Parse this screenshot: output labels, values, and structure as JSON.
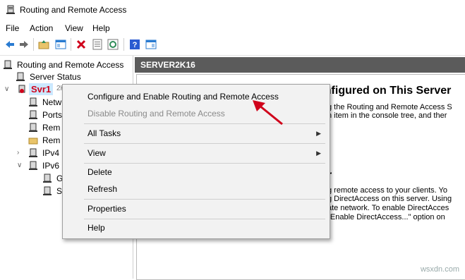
{
  "window": {
    "title": "Routing and Remote Access"
  },
  "menu": [
    "File",
    "Action",
    "View",
    "Help"
  ],
  "toolbar": [
    "back-icon",
    "forward-icon",
    "up-folder-icon",
    "show-hide-tree-icon",
    "delete-icon",
    "properties-icon",
    "refresh-icon",
    "help-icon",
    "export-icon"
  ],
  "tree": {
    "root": "Routing and Remote Access",
    "server_status": "Server Status",
    "server": "Svr1",
    "server_suffix": "2K16",
    "children": [
      "Netw",
      "Ports",
      "Rem",
      "Rem",
      "IPv4",
      "IPv6",
      "G",
      "S"
    ]
  },
  "right": {
    "header": "SERVER2K16",
    "heading1": "onfigured on This Server",
    "line1": "g the Routing and Remote Access S",
    "line2": "n item in the console tree, and ther",
    "heading2": "r",
    "line3": "g remote access to your clients. Yo",
    "line4": "g DirectAccess on this server. Using",
    "line5": "ate network. To enable DirectAcces",
    "line6": "\"Enable DirectAccess...\" option on"
  },
  "context_menu": {
    "configure": "Configure and Enable Routing and Remote Access",
    "disable": "Disable Routing and Remote Access",
    "all_tasks": "All Tasks",
    "view": "View",
    "delete": "Delete",
    "refresh": "Refresh",
    "properties": "Properties",
    "help": "Help"
  },
  "colors": {
    "accent_red": "#d0021b",
    "header_gray": "#5b5b5b",
    "selection": "#cce8ff"
  },
  "watermark": "wsxdn.com"
}
